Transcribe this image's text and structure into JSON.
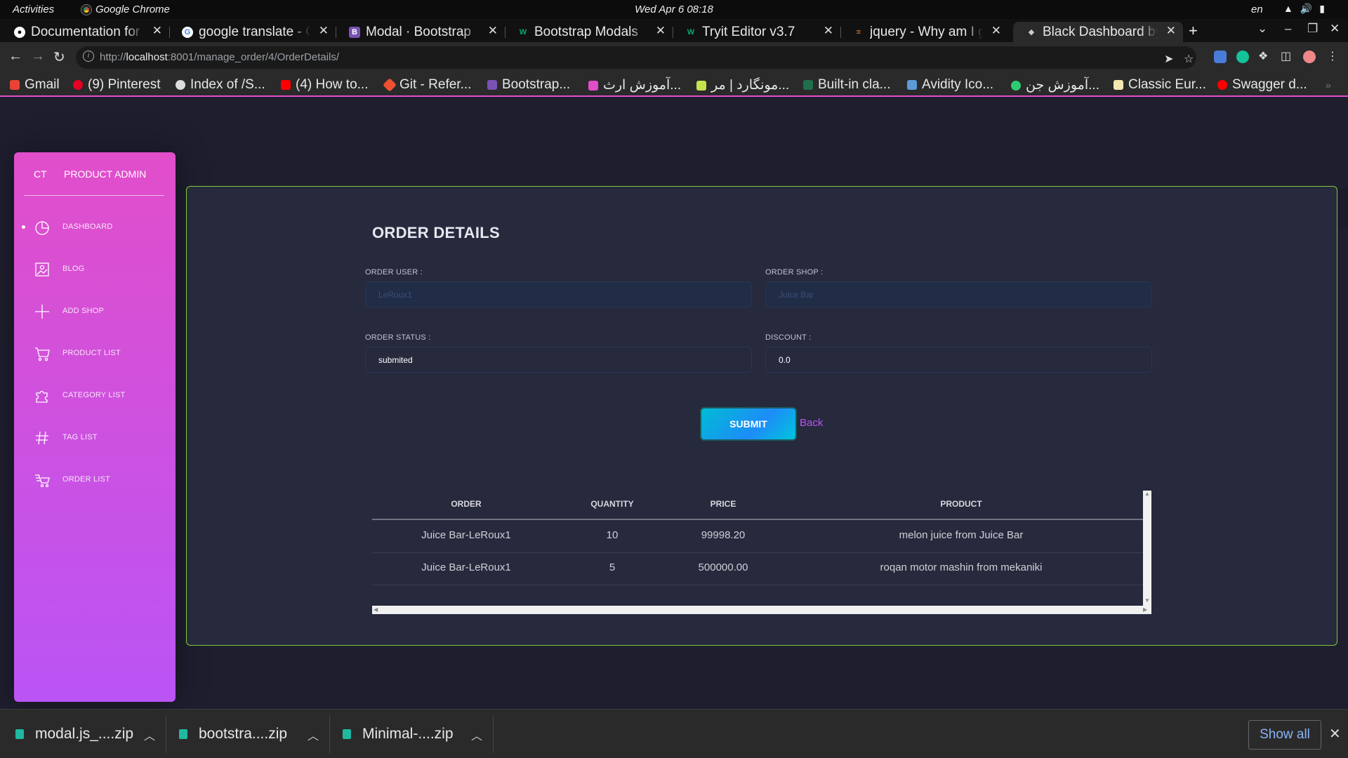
{
  "system_bar": {
    "activities": "Activities",
    "app_name": "Google Chrome",
    "clock": "Wed Apr 6  08:18",
    "lang": "en"
  },
  "tabs": [
    {
      "title": "Documentation for \\",
      "favicon": "github-icon",
      "active": false
    },
    {
      "title": "google translate - Go",
      "favicon": "google-icon",
      "active": false
    },
    {
      "title": "Modal · Bootstrap",
      "favicon": "bootstrap-icon",
      "active": false
    },
    {
      "title": "Bootstrap Modals",
      "favicon": "w3schools-icon",
      "active": false
    },
    {
      "title": "Tryit Editor v3.7",
      "favicon": "w3schools-icon",
      "active": false
    },
    {
      "title": "jquery - Why am I ge",
      "favicon": "stackoverflow-icon",
      "active": false
    },
    {
      "title": "Black Dashboard by C",
      "favicon": "creative-tim-icon",
      "active": true
    }
  ],
  "address_bar": {
    "url_prefix": "http://",
    "url_host": "localhost",
    "url_rest": ":8001/manage_order/4/OrderDetails/"
  },
  "bookmarks": [
    {
      "label": "Gmail",
      "color": "#ea4335"
    },
    {
      "label": "(9) Pinterest",
      "color": "#e60023"
    },
    {
      "label": "Index of /S...",
      "color": "#dddddd"
    },
    {
      "label": "(4) How to...",
      "color": "#ff0000"
    },
    {
      "label": "Git - Refer...",
      "color": "#f05032"
    },
    {
      "label": "Bootstrap...",
      "color": "#7952b3"
    },
    {
      "label": "آموزش ارث...",
      "color": "#e14eca"
    },
    {
      "label": "مونگارد | مر...",
      "color": "#c6e24f"
    },
    {
      "label": "Built-in cla...",
      "color": "#1f6f4a"
    },
    {
      "label": "Avidity Ico...",
      "color": "#5b9bd5"
    },
    {
      "label": "آموزش جن...",
      "color": "#2ecc71"
    },
    {
      "label": "Classic Eur...",
      "color": "#f4e7b0"
    },
    {
      "label": "Swagger d...",
      "color": "#ff0000"
    }
  ],
  "sidebar": {
    "logo_mini": "CT",
    "logo_normal": "PRODUCT ADMIN",
    "items": [
      {
        "label": "DASHBOARD",
        "icon": "chart-pie-icon"
      },
      {
        "label": "BLOG",
        "icon": "image-icon"
      },
      {
        "label": "ADD SHOP",
        "icon": "plus-icon"
      },
      {
        "label": "PRODUCT LIST",
        "icon": "cart-icon"
      },
      {
        "label": "CATEGORY LIST",
        "icon": "puzzle-icon"
      },
      {
        "label": "TAG LIST",
        "icon": "hash-icon"
      },
      {
        "label": "ORDER LIST",
        "icon": "delivery-icon"
      }
    ]
  },
  "order": {
    "title": "ORDER DETAILS",
    "user_label": "ORDER USER :",
    "user_value": "LeRoux1",
    "shop_label": "ORDER SHOP :",
    "shop_value": "Juice Bar",
    "status_label": "ORDER STATUS :",
    "status_value": "submited",
    "discount_label": "DISCOUNT :",
    "discount_value": "0.0",
    "submit_label": "SUBMIT",
    "back_label": "Back"
  },
  "table": {
    "headers": [
      "ORDER",
      "QUANTITY",
      "PRICE",
      "PRODUCT"
    ],
    "rows": [
      [
        "Juice Bar-LeRoux1",
        "10",
        "99998.20",
        "melon juice from Juice Bar"
      ],
      [
        "Juice Bar-LeRoux1",
        "5",
        "500000.00",
        "roqan motor mashin from mekaniki"
      ]
    ]
  },
  "downloads": {
    "items": [
      "modal.js_....zip",
      "bootstra....zip",
      "Minimal-....zip"
    ],
    "show_all": "Show all"
  },
  "colors": {
    "sidebar_top": "#e14eca",
    "sidebar_bottom": "#ba54f5",
    "card_border": "#7dcc36",
    "page_bg": "#1e1e2f",
    "card_bg": "#27293d",
    "accent_link": "#ba54f5"
  }
}
